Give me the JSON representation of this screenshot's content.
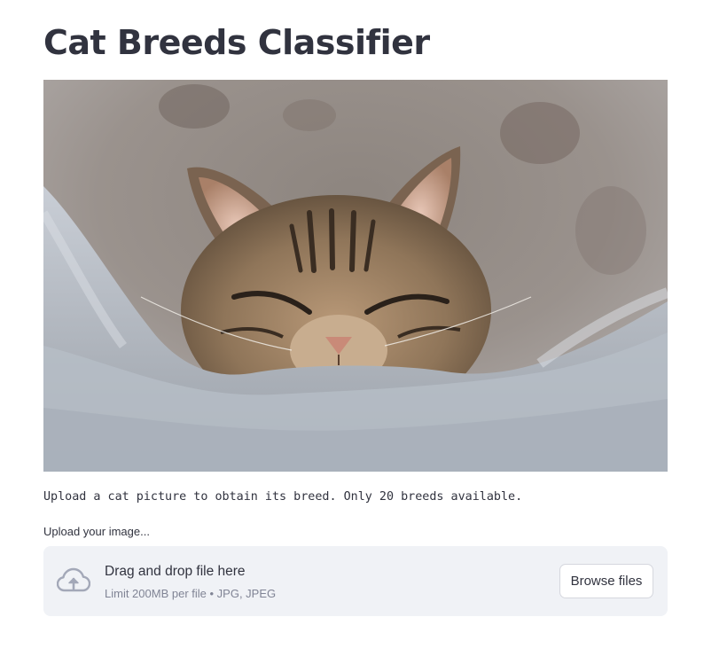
{
  "page": {
    "title": "Cat Breeds Classifier",
    "description": "Upload a cat picture to obtain its breed. Only 20 breeds available."
  },
  "uploader": {
    "label": "Upload your image...",
    "drop_title": "Drag and drop file here",
    "limit_text": "Limit 200MB per file • JPG, JPEG",
    "browse_label": "Browse files",
    "icon": "cloud-upload-icon"
  },
  "colors": {
    "text": "#31333f",
    "muted": "#808495",
    "dropzone_bg": "#f0f2f6",
    "icon": "#a3a8b8"
  }
}
